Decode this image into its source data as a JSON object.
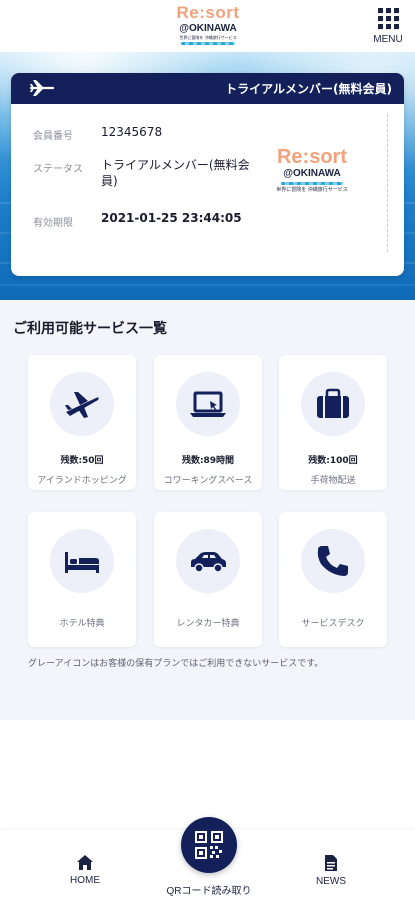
{
  "header": {
    "logo_brand": "Re:sort",
    "logo_sub": "@OKINAWA",
    "logo_tagline": "世界に冒険を 沖縄旅行サービス",
    "menu_label": "MENU"
  },
  "card": {
    "title": "トライアルメンバー(無料会員)",
    "rows": [
      {
        "label": "会員番号",
        "value": "12345678"
      },
      {
        "label": "ステータス",
        "value": "トライアルメンバー(無料会員)"
      },
      {
        "label": "有効期限",
        "value": "2021-01-25 23:44:05"
      }
    ],
    "logo_brand": "Re:sort",
    "logo_sub": "@OKINAWA",
    "logo_tagline": "世界に冒険を 沖縄旅行サービス"
  },
  "services": {
    "title": "ご利用可能サービス一覧",
    "items": [
      {
        "count": "残数:50回",
        "name": "アイランドホッピング",
        "icon": "airplane-icon"
      },
      {
        "count": "残数:89時間",
        "name": "コワーキングスペース",
        "icon": "laptop-icon"
      },
      {
        "count": "残数:100回",
        "name": "手荷物配送",
        "icon": "suitcase-icon"
      },
      {
        "count": "",
        "name": "ホテル特典",
        "icon": "bed-icon"
      },
      {
        "count": "",
        "name": "レンタカー特典",
        "icon": "car-icon"
      },
      {
        "count": "",
        "name": "サービスデスク",
        "icon": "phone-icon"
      }
    ],
    "note": "グレーアイコンはお客様の保有プランではご利用できないサービスです。"
  },
  "nav": {
    "home": "HOME",
    "qr": "QRコード読み取り",
    "news": "NEWS"
  },
  "colors": {
    "navy": "#13205a",
    "brand_peach": "#f0a27c",
    "ocean": "#1e7fcb",
    "background": "#f4f5fa"
  }
}
